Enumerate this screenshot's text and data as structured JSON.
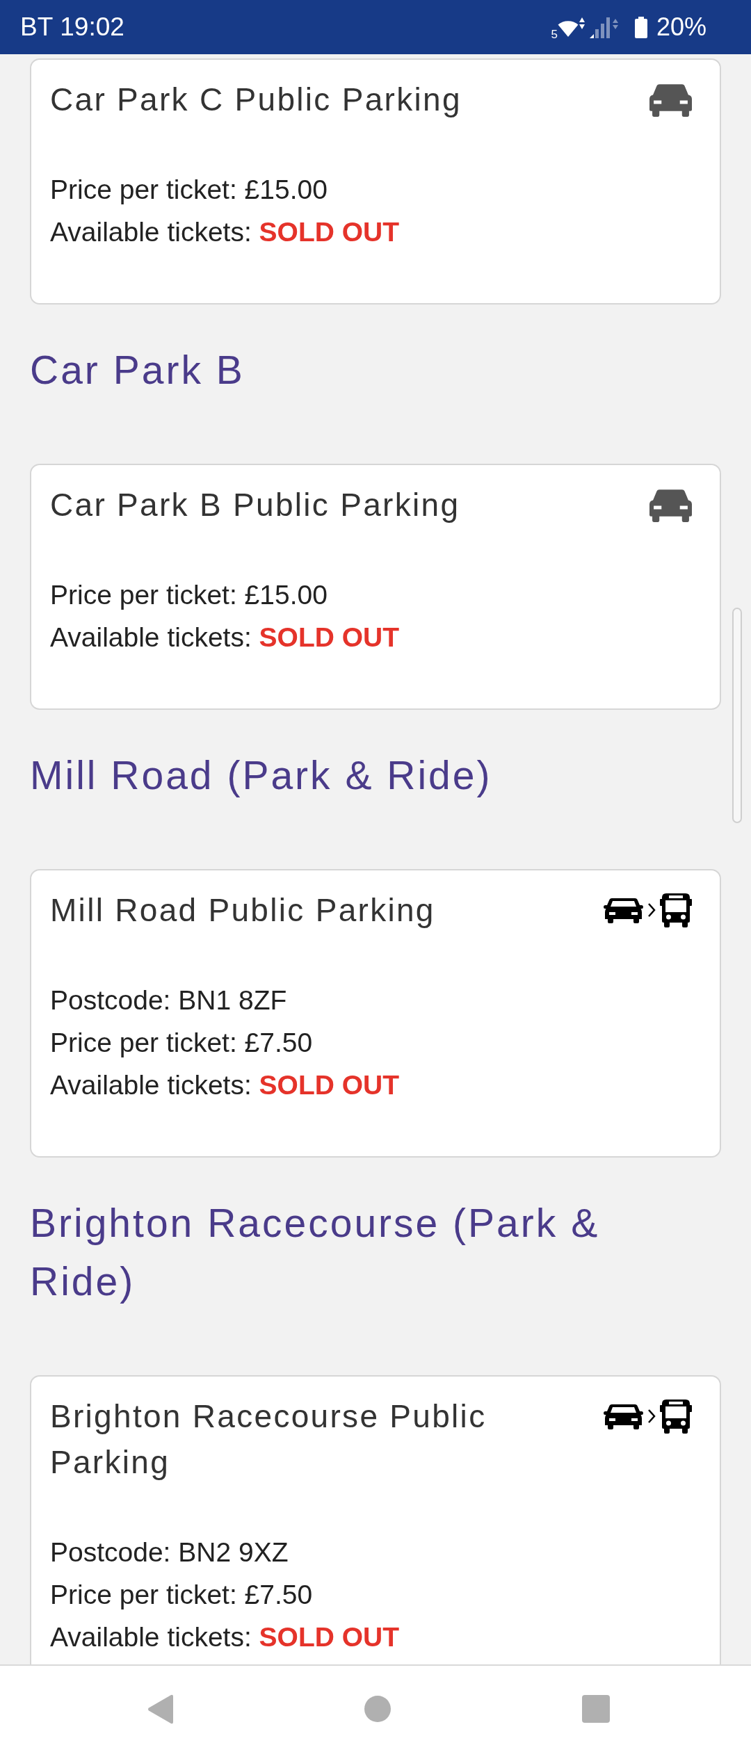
{
  "status_bar": {
    "carrier": "BT",
    "time": "19:02",
    "wifi_band": "5",
    "battery": "20%"
  },
  "sections": [
    {
      "card": {
        "kind": "car_park",
        "title": "Car Park C Public Parking",
        "details": [
          "Price per ticket: £15.00",
          "Available tickets: **SOLD OUT**"
        ]
      }
    },
    {
      "heading": "Car Park B",
      "card": {
        "kind": "car_park",
        "title": "Car Park B Public Parking",
        "details": [
          "Price per ticket: £15.00",
          "Available tickets: **SOLD OUT**"
        ]
      }
    },
    {
      "heading": "Mill Road (Park & Ride)",
      "card": {
        "kind": "park_and_ride",
        "title": "Mill Road Public Parking",
        "details": [
          "Postcode: BN1 8ZF",
          "Price per ticket: £7.50",
          "Available tickets: **SOLD OUT**"
        ]
      }
    },
    {
      "heading": "Brighton Racecourse (Park & Ride)",
      "card": {
        "kind": "park_and_ride",
        "title": "Brighton Racecourse Public Parking",
        "details": [
          "Postcode: BN2 9XZ",
          "Price per ticket: £7.50",
          "Available tickets: **SOLD OUT**"
        ]
      }
    }
  ]
}
